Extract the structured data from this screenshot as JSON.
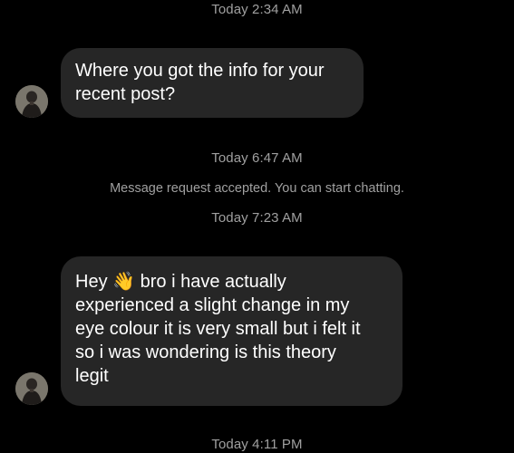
{
  "thread": {
    "timestamp_1": "Today 2:34 AM",
    "message_1_line_1": "Where you got the info for your",
    "message_1_line_2": "recent post?",
    "timestamp_2": "Today 6:47 AM",
    "system_note": "Message request accepted. You can start chatting.",
    "timestamp_3": "Today 7:23 AM",
    "message_2_hey": "Hey",
    "message_2_wave_emoji": "👋",
    "message_2_line_1_rest": "bro i have actually",
    "message_2_line_2": "experienced a slight change in my",
    "message_2_line_3": "eye colour it is very small but i felt it",
    "message_2_line_4": "so i was wondering is this theory",
    "message_2_line_5": "legit",
    "timestamp_4": "Today 4:11 PM"
  },
  "colors": {
    "background": "#000000",
    "bubble": "#262626",
    "timestamp_text": "#a0a0a0",
    "message_text": "#ffffff"
  },
  "icons": {
    "avatar": "sender-avatar-photo"
  }
}
